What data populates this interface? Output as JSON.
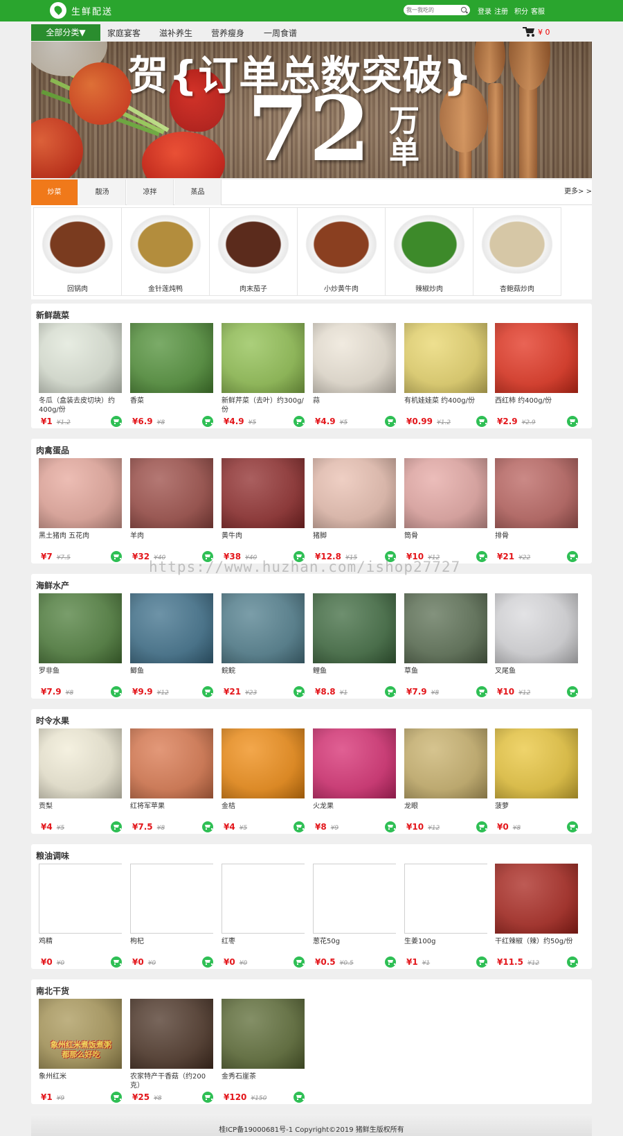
{
  "header": {
    "logo_text": "生鲜配送",
    "search_placeholder": "我一我吃的",
    "login": "登录",
    "register": "注册",
    "points": "积分",
    "service": "客服"
  },
  "nav": {
    "all_categories": "全部分类▼",
    "links": [
      "家庭宴客",
      "滋补养生",
      "营养瘦身",
      "一周食谱"
    ],
    "cart_amount": "¥ 0"
  },
  "banner": {
    "headline": "贺{订单总数突破}",
    "number": "72",
    "unit": "万单"
  },
  "dish_tabs": {
    "tabs": [
      "炒菜",
      "靓汤",
      "凉拌",
      "蒸品"
    ],
    "active_tab": "炒菜",
    "more": "更多> >",
    "dishes": [
      {
        "name": "回锅肉",
        "color": "#7a3b1f"
      },
      {
        "name": "金针莲炖鸭",
        "color": "#b38d3d"
      },
      {
        "name": "肉末茄子",
        "color": "#5b2b1c"
      },
      {
        "name": "小炒黄牛肉",
        "color": "#8a3f20"
      },
      {
        "name": "辣椒炒肉",
        "color": "#3d8a2a"
      },
      {
        "name": "杏鲍菇炒肉",
        "color": "#d6c7a6"
      }
    ]
  },
  "sections": [
    {
      "title": "新鲜蔬菜",
      "products": [
        {
          "name": "冬瓜（盒装去皮切块）约400g/份",
          "price": "¥1",
          "old_price": "¥1.2",
          "color": "#dfe6d8"
        },
        {
          "name": "香菜",
          "price": "¥6.9",
          "old_price": "¥8",
          "color": "#4f8f36"
        },
        {
          "name": "新鲜芹菜（去叶）约300g/份",
          "price": "¥4.9",
          "old_price": "¥5",
          "color": "#8fbf4f"
        },
        {
          "name": "蒜",
          "price": "¥4.9",
          "old_price": "¥5",
          "color": "#ece4d6"
        },
        {
          "name": "有机娃娃菜 约400g/份",
          "price": "¥0.99",
          "old_price": "¥1.2",
          "color": "#e8d56a"
        },
        {
          "name": "西红柿 约400g/份",
          "price": "¥2.9",
          "old_price": "¥2.9",
          "color": "#e2301c"
        }
      ]
    },
    {
      "title": "肉禽蛋品",
      "products": [
        {
          "name": "黑土猪肉 五花肉",
          "price": "¥7",
          "old_price": "¥7.5",
          "color": "#e6a79b"
        },
        {
          "name": "羊肉",
          "price": "¥32",
          "old_price": "¥40",
          "color": "#9b4b45"
        },
        {
          "name": "黄牛肉",
          "price": "¥38",
          "old_price": "¥40",
          "color": "#8e2a2a"
        },
        {
          "name": "猪脚",
          "price": "¥12.8",
          "old_price": "¥15",
          "color": "#e9bfb0"
        },
        {
          "name": "筒骨",
          "price": "¥10",
          "old_price": "¥12",
          "color": "#e5a7a3"
        },
        {
          "name": "排骨",
          "price": "¥21",
          "old_price": "¥22",
          "color": "#b9625e"
        }
      ]
    },
    {
      "title": "海鲜水产",
      "products": [
        {
          "name": "罗非鱼",
          "price": "¥7.9",
          "old_price": "¥8",
          "color": "#4d7d3a"
        },
        {
          "name": "鲫鱼",
          "price": "¥9.9",
          "old_price": "¥12",
          "color": "#3d6f8a"
        },
        {
          "name": "鲩鲩",
          "price": "¥21",
          "old_price": "¥23",
          "color": "#4f7d8c"
        },
        {
          "name": "鲤鱼",
          "price": "¥8.8",
          "old_price": "¥1",
          "color": "#3e6a3f"
        },
        {
          "name": "草鱼",
          "price": "¥7.9",
          "old_price": "¥8",
          "color": "#5a6e52"
        },
        {
          "name": "叉尾鱼",
          "price": "¥10",
          "old_price": "¥12",
          "color": "#d9d9dc"
        }
      ]
    },
    {
      "title": "时令水果",
      "products": [
        {
          "name": "贡梨",
          "price": "¥4",
          "old_price": "¥5",
          "color": "#f1ecd6"
        },
        {
          "name": "红将军苹果",
          "price": "¥7.5",
          "old_price": "¥8",
          "color": "#d9764c"
        },
        {
          "name": "金桔",
          "price": "¥4",
          "old_price": "¥5",
          "color": "#ef8a10"
        },
        {
          "name": "火龙果",
          "price": "¥8",
          "old_price": "¥9",
          "color": "#d62b70"
        },
        {
          "name": "龙眼",
          "price": "¥10",
          "old_price": "¥12",
          "color": "#c8b06a"
        },
        {
          "name": "菠萝",
          "price": "¥0",
          "old_price": "¥8",
          "color": "#e9c53a"
        }
      ]
    },
    {
      "title": "粮油调味",
      "products": [
        {
          "name": "鸡精",
          "price": "¥0",
          "old_price": "¥0",
          "color": "blank"
        },
        {
          "name": "枸杞",
          "price": "¥0",
          "old_price": "¥0",
          "color": "blank"
        },
        {
          "name": "红枣",
          "price": "¥0",
          "old_price": "¥0",
          "color": "blank"
        },
        {
          "name": "葱花50g",
          "price": "¥0.5",
          "old_price": "¥0.5",
          "color": "blank"
        },
        {
          "name": "生姜100g",
          "price": "¥1",
          "old_price": "¥1",
          "color": "blank"
        },
        {
          "name": "干红辣椒（辣）约50g/份",
          "price": "¥11.5",
          "old_price": "¥12",
          "color": "#a8241c"
        }
      ]
    },
    {
      "title": "南北干货",
      "products": [
        {
          "name": "象州红米",
          "price": "¥1",
          "old_price": "¥9",
          "color": "#a99758",
          "overlay": "象州红米煮饭煮粥\n都那么好吃"
        },
        {
          "name": "农家特产干香菇（约200克）",
          "price": "¥25",
          "old_price": "¥8",
          "color": "#4b3325"
        },
        {
          "name": "金秀石崖茶",
          "price": "¥120",
          "old_price": "¥150",
          "color": "#5b6a34"
        }
      ]
    }
  ],
  "watermark": "https://www.huzhan.com/ishop27727",
  "footer": "桂ICP备19000681号-1 Copyright©2019 猪鲜生版权所有"
}
